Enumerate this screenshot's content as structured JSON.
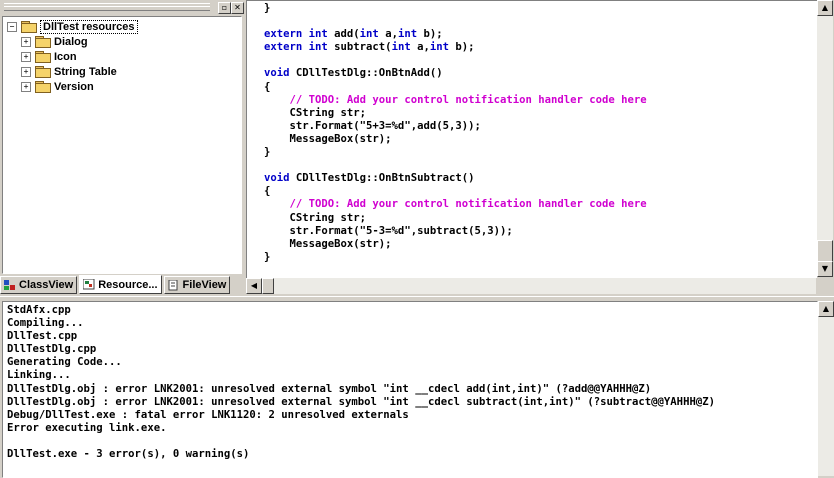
{
  "workspace": {
    "tree": [
      {
        "label": "DllTest resources",
        "expander": "−",
        "depth": 0,
        "selected": true
      },
      {
        "label": "Dialog",
        "expander": "+",
        "depth": 1
      },
      {
        "label": "Icon",
        "expander": "+",
        "depth": 1
      },
      {
        "label": "String Table",
        "expander": "+",
        "depth": 1
      },
      {
        "label": "Version",
        "expander": "+",
        "depth": 1
      }
    ],
    "tabs": [
      {
        "label": "ClassView",
        "active": false
      },
      {
        "label": "Resource...",
        "active": true
      },
      {
        "label": "FileView",
        "active": false
      }
    ]
  },
  "editor": {
    "code_lines": [
      [
        {
          "t": "}"
        }
      ],
      [
        {
          "t": ""
        }
      ],
      [
        {
          "t": "extern int",
          "k": "kw"
        },
        {
          "t": " add("
        },
        {
          "t": "int",
          "k": "kw"
        },
        {
          "t": " a,"
        },
        {
          "t": "int",
          "k": "kw"
        },
        {
          "t": " b);"
        }
      ],
      [
        {
          "t": "extern int",
          "k": "kw"
        },
        {
          "t": " subtract("
        },
        {
          "t": "int",
          "k": "kw"
        },
        {
          "t": " a,"
        },
        {
          "t": "int",
          "k": "kw"
        },
        {
          "t": " b);"
        }
      ],
      [
        {
          "t": ""
        }
      ],
      [
        {
          "t": "void",
          "k": "kw"
        },
        {
          "t": " CDllTestDlg::OnBtnAdd()"
        }
      ],
      [
        {
          "t": "{"
        }
      ],
      [
        {
          "t": "    "
        },
        {
          "t": "// TODO: Add your control notification handler code here",
          "k": "cm"
        }
      ],
      [
        {
          "t": "    CString str;"
        }
      ],
      [
        {
          "t": "    str.Format(\"5+3=%d\",add(5,3));"
        }
      ],
      [
        {
          "t": "    MessageBox(str);"
        }
      ],
      [
        {
          "t": "}"
        }
      ],
      [
        {
          "t": ""
        }
      ],
      [
        {
          "t": "void",
          "k": "kw"
        },
        {
          "t": " CDllTestDlg::OnBtnSubtract()"
        }
      ],
      [
        {
          "t": "{"
        }
      ],
      [
        {
          "t": "    "
        },
        {
          "t": "// TODO: Add your control notification handler code here",
          "k": "cm"
        }
      ],
      [
        {
          "t": "    CString str;"
        }
      ],
      [
        {
          "t": "    str.Format(\"5-3=%d\",subtract(5,3));"
        }
      ],
      [
        {
          "t": "    MessageBox(str);"
        }
      ],
      [
        {
          "t": "}"
        }
      ]
    ]
  },
  "output": {
    "lines": [
      "StdAfx.cpp",
      "Compiling...",
      "DllTest.cpp",
      "DllTestDlg.cpp",
      "Generating Code...",
      "Linking...",
      "DllTestDlg.obj : error LNK2001: unresolved external symbol \"int __cdecl add(int,int)\" (?add@@YAHHH@Z)",
      "DllTestDlg.obj : error LNK2001: unresolved external symbol \"int __cdecl subtract(int,int)\" (?subtract@@YAHHH@Z)",
      "Debug/DllTest.exe : fatal error LNK1120: 2 unresolved externals",
      "Error executing link.exe.",
      "",
      "DllTest.exe - 3 error(s), 0 warning(s)"
    ]
  },
  "colors": {
    "keyword": "#0000c8",
    "comment": "#d000d0",
    "chrome": "#d4d0c8"
  }
}
